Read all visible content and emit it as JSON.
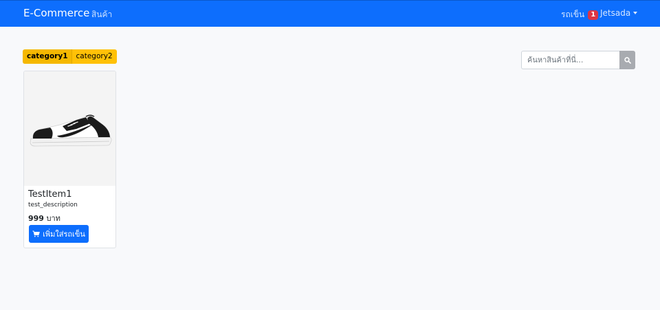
{
  "navbar": {
    "brand": "E-Commerce",
    "products_link": "สินค้า",
    "cart_label": "รถเข็น",
    "cart_count": "1",
    "user_name": "Jetsada"
  },
  "categories": [
    {
      "label": "category1",
      "active": true
    },
    {
      "label": "category2",
      "active": false
    }
  ],
  "search": {
    "placeholder": "ค้นหาสินค้าที่นี่...",
    "value": "",
    "icon": "search-icon"
  },
  "products": [
    {
      "name": "TestItem1",
      "description": "test_description",
      "price": "999",
      "currency": "บาท",
      "add_to_cart_label": "เพิ่มใส่รถเข็น",
      "image": "sneaker-image"
    }
  ],
  "colors": {
    "primary": "#0d6efd",
    "warning": "#ffc107",
    "danger": "#dc3545",
    "search_button": "#a8abb0"
  }
}
